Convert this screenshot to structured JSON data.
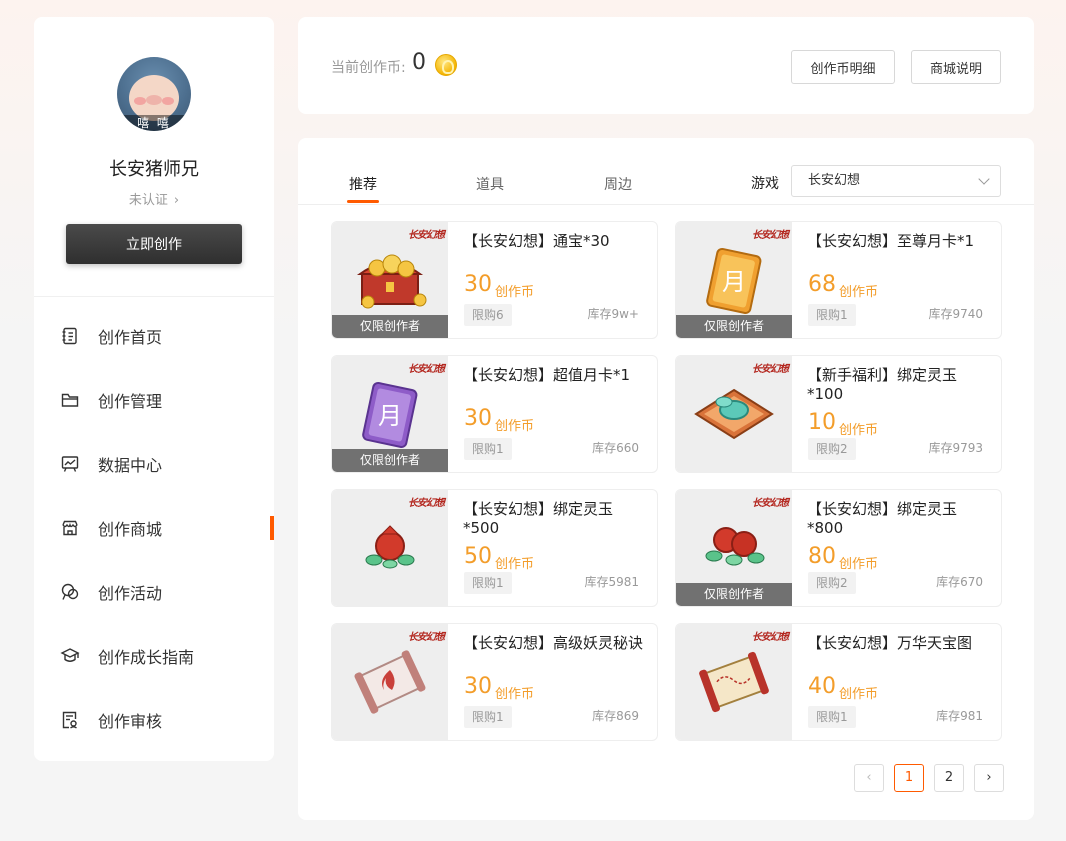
{
  "sidebar": {
    "username": "长安猪师兄",
    "auth_status": "未认证",
    "avatar_caption": "嘻 嘻",
    "create_button": "立即创作",
    "nav": [
      {
        "label": "创作首页",
        "icon": "notebook-icon"
      },
      {
        "label": "创作管理",
        "icon": "folder-icon"
      },
      {
        "label": "数据中心",
        "icon": "chart-board-icon"
      },
      {
        "label": "创作商城",
        "icon": "shop-icon",
        "active": true
      },
      {
        "label": "创作活动",
        "icon": "activity-icon"
      },
      {
        "label": "创作成长指南",
        "icon": "graduation-cap-icon"
      },
      {
        "label": "创作审核",
        "icon": "review-icon"
      }
    ]
  },
  "topbar": {
    "coin_label": "当前创作币:",
    "coin_value": "0",
    "detail_button": "创作币明细",
    "explain_button": "商城说明"
  },
  "tabs": [
    {
      "label": "推荐",
      "active": true
    },
    {
      "label": "道具"
    },
    {
      "label": "周边"
    }
  ],
  "filter": {
    "game_label": "游戏",
    "game_value": "长安幻想"
  },
  "products": [
    {
      "title": "【长安幻想】通宝*30",
      "price": "30",
      "unit": "创作币",
      "limit": "限购6",
      "stock": "库存9w+",
      "badge": "仅限创作者",
      "logo": "长安幻想",
      "image": "treasure-chest-icon"
    },
    {
      "title": "【长安幻想】至尊月卡*1",
      "price": "68",
      "unit": "创作币",
      "limit": "限购1",
      "stock": "库存9740",
      "badge": "仅限创作者",
      "logo": "长安幻想",
      "image": "gold-month-card-icon",
      "card_char": "月"
    },
    {
      "title": "【长安幻想】超值月卡*1",
      "price": "30",
      "unit": "创作币",
      "limit": "限购1",
      "stock": "库存660",
      "badge": "仅限创作者",
      "logo": "长安幻想",
      "image": "purple-month-card-icon",
      "card_char": "月"
    },
    {
      "title": "【新手福利】绑定灵玉*100",
      "price": "10",
      "unit": "创作币",
      "limit": "限购2",
      "stock": "库存9793",
      "badge": "",
      "logo": "长安幻想",
      "image": "jade-tile-icon"
    },
    {
      "title": "【长安幻想】绑定灵玉*500",
      "price": "50",
      "unit": "创作币",
      "limit": "限购1",
      "stock": "库存5981",
      "badge": "",
      "logo": "长安幻想",
      "image": "jade-bag-icon"
    },
    {
      "title": "【长安幻想】绑定灵玉*800",
      "price": "80",
      "unit": "创作币",
      "limit": "限购2",
      "stock": "库存670",
      "badge": "仅限创作者",
      "logo": "长安幻想",
      "image": "jade-bags-icon"
    },
    {
      "title": "【长安幻想】高级妖灵秘诀",
      "price": "30",
      "unit": "创作币",
      "limit": "限购1",
      "stock": "库存869",
      "badge": "",
      "logo": "长安幻想",
      "image": "flame-scroll-icon"
    },
    {
      "title": "【长安幻想】万华天宝图",
      "price": "40",
      "unit": "创作币",
      "limit": "限购1",
      "stock": "库存981",
      "badge": "",
      "logo": "长安幻想",
      "image": "map-scroll-icon"
    }
  ],
  "pagination": {
    "pages": [
      "1",
      "2"
    ],
    "current": "1",
    "prev": "‹",
    "next": "›"
  },
  "colors": {
    "accent": "#ff5a00",
    "price": "#f39d2a"
  }
}
